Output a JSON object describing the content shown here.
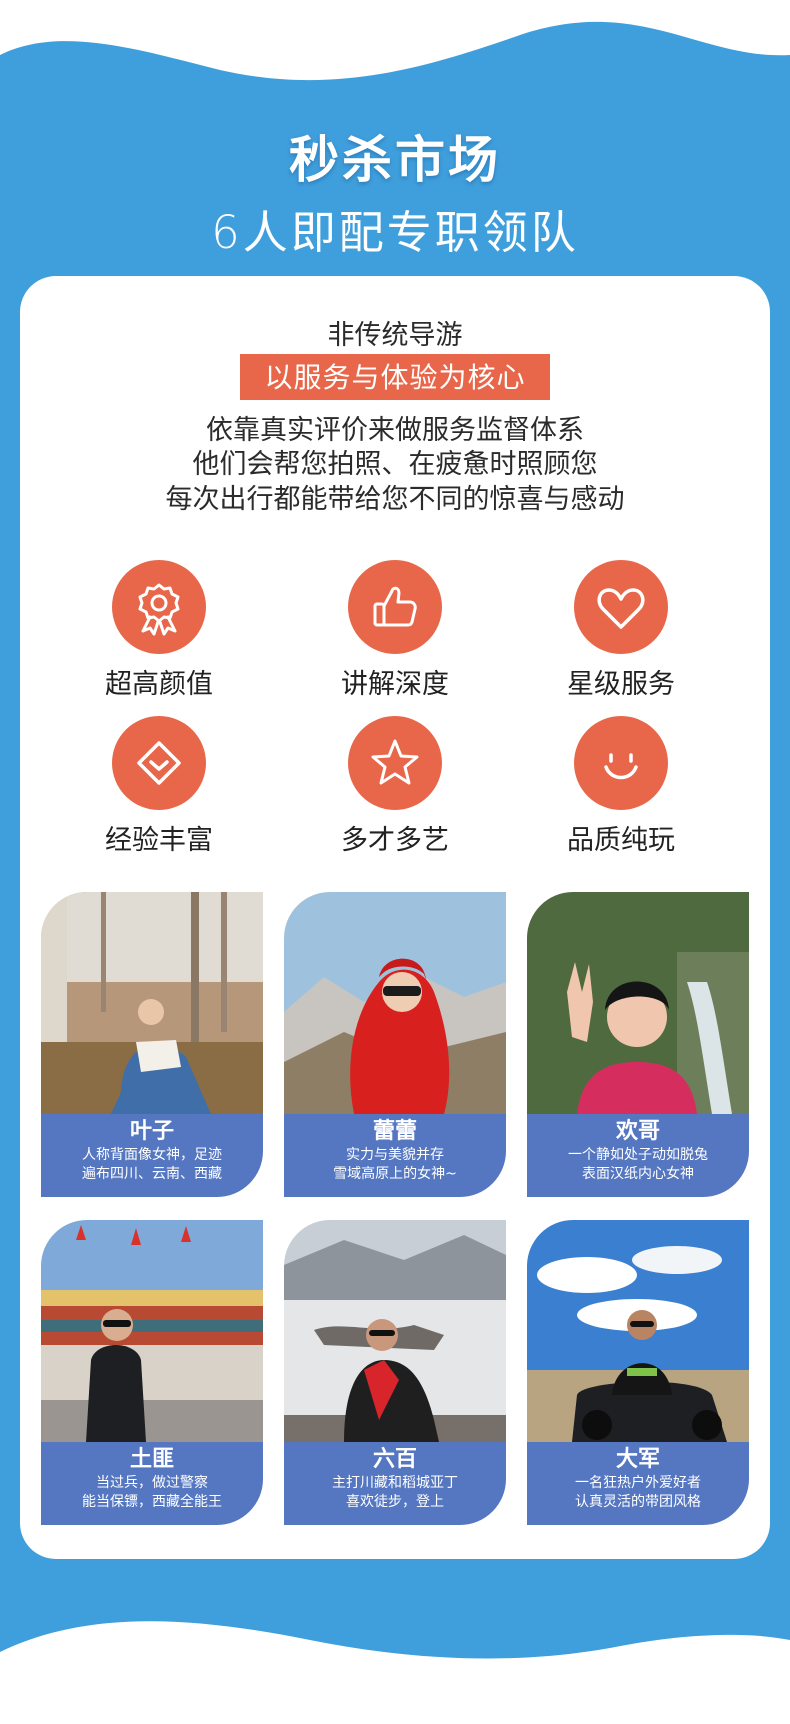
{
  "header": {
    "title": "秒杀市场",
    "subtitle": "6人即配专职领队"
  },
  "intro": {
    "line1": "非传统导游",
    "highlight": "以服务与体验为核心",
    "line2": "依靠真实评价来做服务监督体系",
    "line3": "他们会帮您拍照、在疲惫时照顾您",
    "line4": "每次出行都能带给您不同的惊喜与感动"
  },
  "features": [
    {
      "label": "超高颜值",
      "icon": "award-ribbon-icon"
    },
    {
      "label": "讲解深度",
      "icon": "thumbs-up-icon"
    },
    {
      "label": "星级服务",
      "icon": "heart-icon"
    },
    {
      "label": "经验丰富",
      "icon": "shield-check-icon"
    },
    {
      "label": "多才多艺",
      "icon": "star-icon"
    },
    {
      "label": "品质纯玩",
      "icon": "smile-icon"
    }
  ],
  "guides": [
    {
      "name": "叶子",
      "desc1": "人称背面像女神，足迹",
      "desc2": "遍布四川、云南、西藏"
    },
    {
      "name": "蕾蕾",
      "desc1": "实力与美貌并存",
      "desc2": "雪域高原上的女神~"
    },
    {
      "name": "欢哥",
      "desc1": "一个静如处子动如脱兔",
      "desc2": "表面汉纸内心女神"
    },
    {
      "name": "土匪",
      "desc1": "当过兵，做过警察",
      "desc2": "能当保镖，西藏全能王"
    },
    {
      "name": "六百",
      "desc1": "主打川藏和稻城亚丁",
      "desc2": "喜欢徒步，登上"
    },
    {
      "name": "大军",
      "desc1": "一名狂热户外爱好者",
      "desc2": "认真灵活的带团风格"
    }
  ],
  "colors": {
    "background_blue": "#3f9fdc",
    "accent_orange": "#e8674a",
    "band_blue": "#5577c1"
  }
}
